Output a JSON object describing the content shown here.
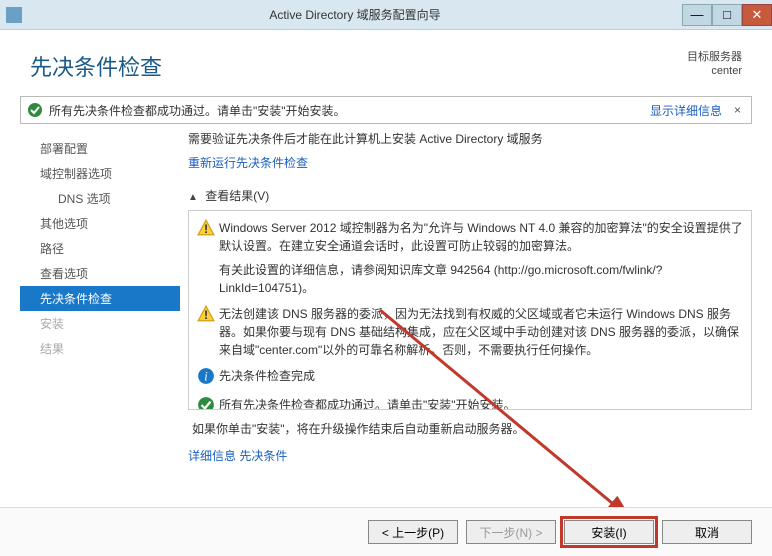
{
  "titlebar": {
    "title": "Active Directory 域服务配置向导"
  },
  "header": {
    "title": "先决条件检查",
    "target_label": "目标服务器",
    "target_value": "center"
  },
  "successbar": {
    "msg": "所有先决条件检查都成功通过。请单击\"安装\"开始安装。",
    "detail": "显示详细信息",
    "close": "×"
  },
  "sidebar": {
    "items": [
      {
        "label": "部署配置"
      },
      {
        "label": "域控制器选项"
      },
      {
        "label": "DNS 选项"
      },
      {
        "label": "其他选项"
      },
      {
        "label": "路径"
      },
      {
        "label": "查看选项"
      },
      {
        "label": "先决条件检查"
      },
      {
        "label": "安装"
      },
      {
        "label": "结果"
      }
    ]
  },
  "main": {
    "intro": "需要验证先决条件后才能在此计算机上安装 Active Directory 域服务",
    "rerun": "重新运行先决条件检查",
    "seclabel": "查看结果(V)",
    "entries": [
      {
        "kind": "warn",
        "text": "Windows Server 2012 域控制器为名为\"允许与 Windows NT 4.0 兼容的加密算法\"的安全设置提供了默认设置。在建立安全通道会话时，此设置可防止较弱的加密算法。",
        "subtext": "有关此设置的详细信息，请参阅知识库文章 942564 (http://go.microsoft.com/fwlink/?LinkId=104751)。"
      },
      {
        "kind": "warn",
        "text": "无法创建该 DNS 服务器的委派，因为无法找到有权威的父区域或者它未运行 Windows DNS 服务器。如果你要与现有 DNS 基础结构集成，应在父区域中手动创建对该 DNS 服务器的委派，以确保来自域\"center.com\"以外的可靠名称解析。否则，不需要执行任何操作。"
      },
      {
        "kind": "info",
        "text": "先决条件检查完成"
      },
      {
        "kind": "ok",
        "text": "所有先决条件检查都成功通过。请单击\"安装\"开始安装。"
      }
    ],
    "restartnote": "如果你单击\"安装\"，将在升级操作结束后自动重新启动服务器。",
    "morelink": "详细信息 先决条件"
  },
  "footer": {
    "prev": "< 上一步(P)",
    "next": "下一步(N) >",
    "install": "安装(I)",
    "cancel": "取消"
  }
}
